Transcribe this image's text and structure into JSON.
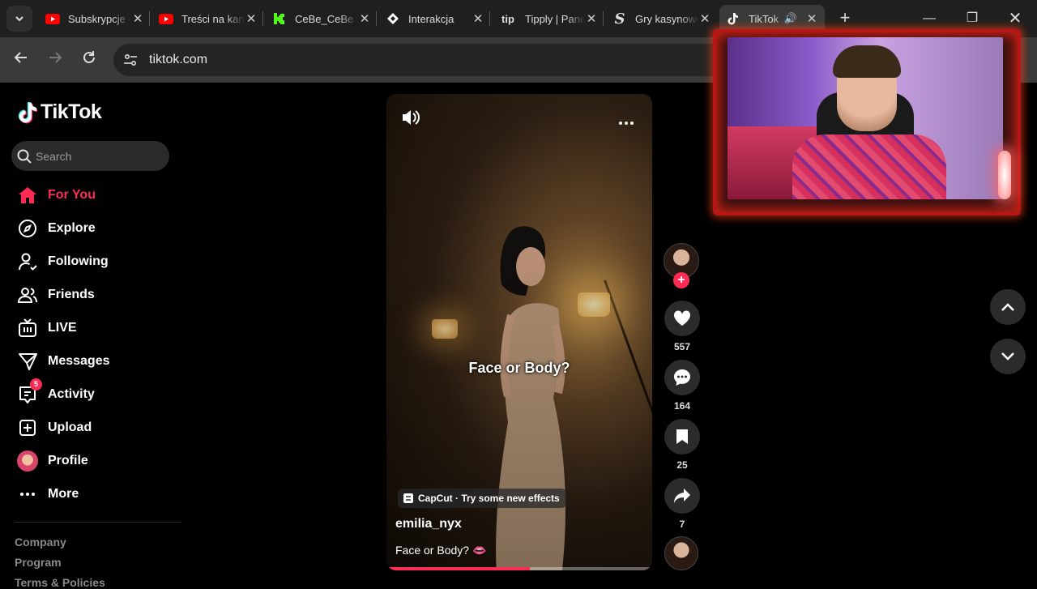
{
  "browser": {
    "tabs": [
      {
        "title": "Subskrypcje - YouTube",
        "favicon": "youtube-icon"
      },
      {
        "title": "Treści na kanale",
        "favicon": "youtube-icon"
      },
      {
        "title": "CeBe_CeBe",
        "favicon": "kick-icon"
      },
      {
        "title": "Interakcja",
        "favicon": "diamond-icon"
      },
      {
        "title": "Tipply | Panel",
        "favicon": "tipply-icon"
      },
      {
        "title": "Gry kasynowe",
        "favicon": "s-icon"
      },
      {
        "title": "TikTok",
        "favicon": "tiktok-icon",
        "active": true
      }
    ],
    "tipply_favicon_text": "tip",
    "s_favicon_text": "S",
    "url": "tiktok.com"
  },
  "sidebar": {
    "logo_text": "TikTok",
    "search_placeholder": "Search",
    "nav": [
      {
        "label": "For You",
        "icon": "home-icon",
        "active": true
      },
      {
        "label": "Explore",
        "icon": "compass-icon"
      },
      {
        "label": "Following",
        "icon": "following-icon"
      },
      {
        "label": "Friends",
        "icon": "friends-icon"
      },
      {
        "label": "LIVE",
        "icon": "live-icon"
      },
      {
        "label": "Messages",
        "icon": "messages-icon"
      },
      {
        "label": "Activity",
        "icon": "activity-icon",
        "badge": "5"
      },
      {
        "label": "Upload",
        "icon": "upload-icon"
      },
      {
        "label": "Profile",
        "icon": "profile-avatar"
      },
      {
        "label": "More",
        "icon": "more-icon"
      }
    ],
    "footer_links": [
      "Company",
      "Program",
      "Terms & Policies"
    ]
  },
  "video": {
    "center_caption": "Face or Body?",
    "effect_chip": "CapCut · Try some new effects",
    "username": "emilia_nyx",
    "description": "Face or Body? 👄",
    "progress": 0.54
  },
  "actions": {
    "likes": "557",
    "comments": "164",
    "bookmarks": "25",
    "shares": "7"
  },
  "colors": {
    "accent": "#fe2c55",
    "background": "#000000",
    "tab_bar": "#1f1f1f",
    "toolbar": "#3a3a3a"
  }
}
